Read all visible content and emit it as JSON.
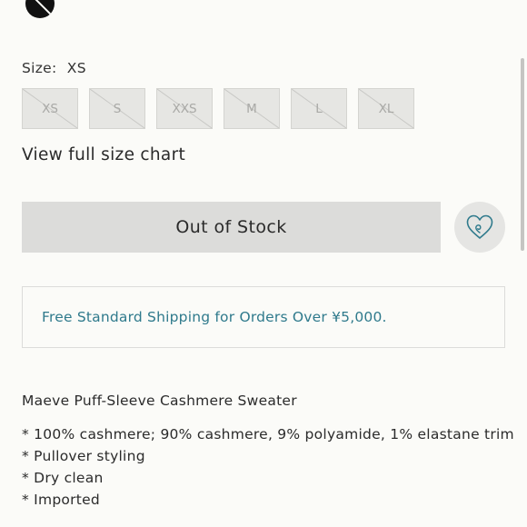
{
  "size": {
    "label": "Size:",
    "selected": "XS",
    "options": [
      "XS",
      "S",
      "XXS",
      "M",
      "L",
      "XL"
    ]
  },
  "size_chart_link": "View full size chart",
  "stock_button": "Out of Stock",
  "wishlist_icon": "heart-icon",
  "shipping_notice": "Free Standard Shipping for Orders Over ¥5,000.",
  "product": {
    "title": "Maeve Puff-Sleeve Cashmere Sweater",
    "details": [
      "* 100% cashmere; 90% cashmere, 9% polyamide, 1% elastane trim",
      "* Pullover styling",
      "* Dry clean",
      "* Imported"
    ]
  },
  "colors": {
    "accent": "#2f7a8c",
    "button": "#dcdcda",
    "background": "#fbfbf8"
  }
}
